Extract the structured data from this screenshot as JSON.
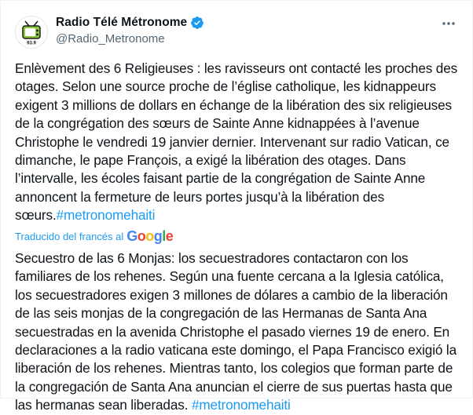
{
  "author": {
    "display_name": "Radio Télé Métronome",
    "handle": "@Radio_Metronome",
    "avatar_text": "93.9"
  },
  "tweet": {
    "original_text": "Enlèvement des 6 Religieuses : les ravisseurs ont contacté les proches des otages. Selon une source proche de l’église catholique, les kidnappeurs exigent 3 millions de dollars en échange de la libération des six religieuses de la congrégation des sœurs de Sainte Anne kidnappées à l’avenue Christophe le vendredi 19 janvier dernier. Intervenant sur radio Vatican, ce dimanche, le pape François, a exigé la libération des otages. Dans l’intervalle, les écoles faisant partie de la congrégation de Sainte Anne annoncent la fermeture de leurs portes jusqu’à la libération des sœurs.",
    "original_hashtag": "#metronomehaiti",
    "translated_label": "Traducido del francés al",
    "google_letters": [
      "G",
      "o",
      "o",
      "g",
      "l",
      "e"
    ],
    "translated_text": "Secuestro de las 6 Monjas: los secuestradores contactaron con los familiares de los rehenes. Según una fuente cercana a la Iglesia católica, los secuestradores exigen 3 millones de dólares a cambio de la liberación de las seis monjas de la congregación de las Hermanas de Santa Ana secuestradas en la avenida Christophe el pasado viernes 19 de enero. En declaraciones a la radio vaticana este domingo, el Papa Francisco exigió la liberación de los rehenes. Mientras tanto, los colegios que forman parte de la congregación de Santa Ana anuncian el cierre de sus puertas hasta que las hermanas sean liberadas. ",
    "translated_hashtag": "#metronomehaiti"
  },
  "colors": {
    "link": "#1d9bf0",
    "secondary_text": "#536471",
    "verified_badge": "#1d9bf0"
  },
  "icons": {
    "verified": "verified-badge-icon",
    "more": "more-options-icon",
    "avatar": "radio-tv-logo"
  }
}
